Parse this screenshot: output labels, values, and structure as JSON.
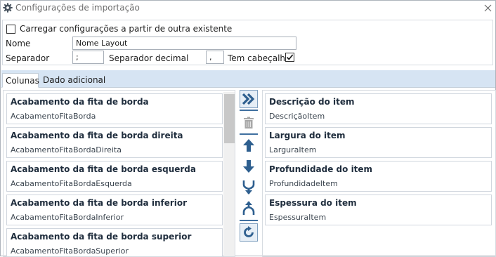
{
  "window": {
    "title": "Configurações de importação",
    "icons": {
      "settings": "gear-icon",
      "close": "close-icon"
    }
  },
  "config": {
    "load_checkbox_label": "Carregar configurações a partir de outra existente",
    "load_checked": false,
    "name_label": "Nome",
    "name_value": "Nome Layout",
    "separator_label": "Separador",
    "separator_value": ";",
    "decimal_separator_label": "Separador decimal",
    "decimal_separator_value": ",",
    "header_label": "Tem cabeçalho",
    "header_checked": true
  },
  "tabs": [
    {
      "label": "Colunas",
      "active": true
    },
    {
      "label": "Dado adicional",
      "active": false
    }
  ],
  "available_columns": [
    {
      "title": "Acabamento da fita de borda",
      "field": "AcabamentoFitaBorda"
    },
    {
      "title": "Acabamento da fita de borda direita",
      "field": "AcabamentoFitaBordaDireita"
    },
    {
      "title": "Acabamento da fita de borda esquerda",
      "field": "AcabamentoFitaBordaEsquerda"
    },
    {
      "title": "Acabamento da fita de borda inferior",
      "field": "AcabamentoFitaBordaInferior"
    },
    {
      "title": "Acabamento da fita de borda superior",
      "field": "AcabamentoFitaBordaSuperior"
    }
  ],
  "selected_columns": [
    {
      "title": "Descrição do item",
      "field": "DescriçãoItem"
    },
    {
      "title": "Largura do item",
      "field": "LarguraItem"
    },
    {
      "title": "Profundidade do item",
      "field": "ProfundidadeItem"
    },
    {
      "title": "Espessura do item",
      "field": "EspessuraItem"
    }
  ],
  "toolbar": [
    {
      "name": "add-all-button",
      "icon": "double-chevron-right-icon",
      "enabled": true
    },
    {
      "name": "delete-button",
      "icon": "trash-icon",
      "enabled": false
    },
    {
      "name": "move-up-button",
      "icon": "arrow-up-icon",
      "enabled": true
    },
    {
      "name": "move-down-button",
      "icon": "arrow-down-icon",
      "enabled": true
    },
    {
      "name": "merge-button",
      "icon": "merge-icon",
      "enabled": true
    },
    {
      "name": "split-button",
      "icon": "split-icon",
      "enabled": true
    },
    {
      "name": "refresh-button",
      "icon": "refresh-icon",
      "enabled": true
    }
  ],
  "colors": {
    "accent": "#2e5f8f",
    "tab_strip": "#d6e4f3",
    "disabled": "#a8a8a8"
  }
}
